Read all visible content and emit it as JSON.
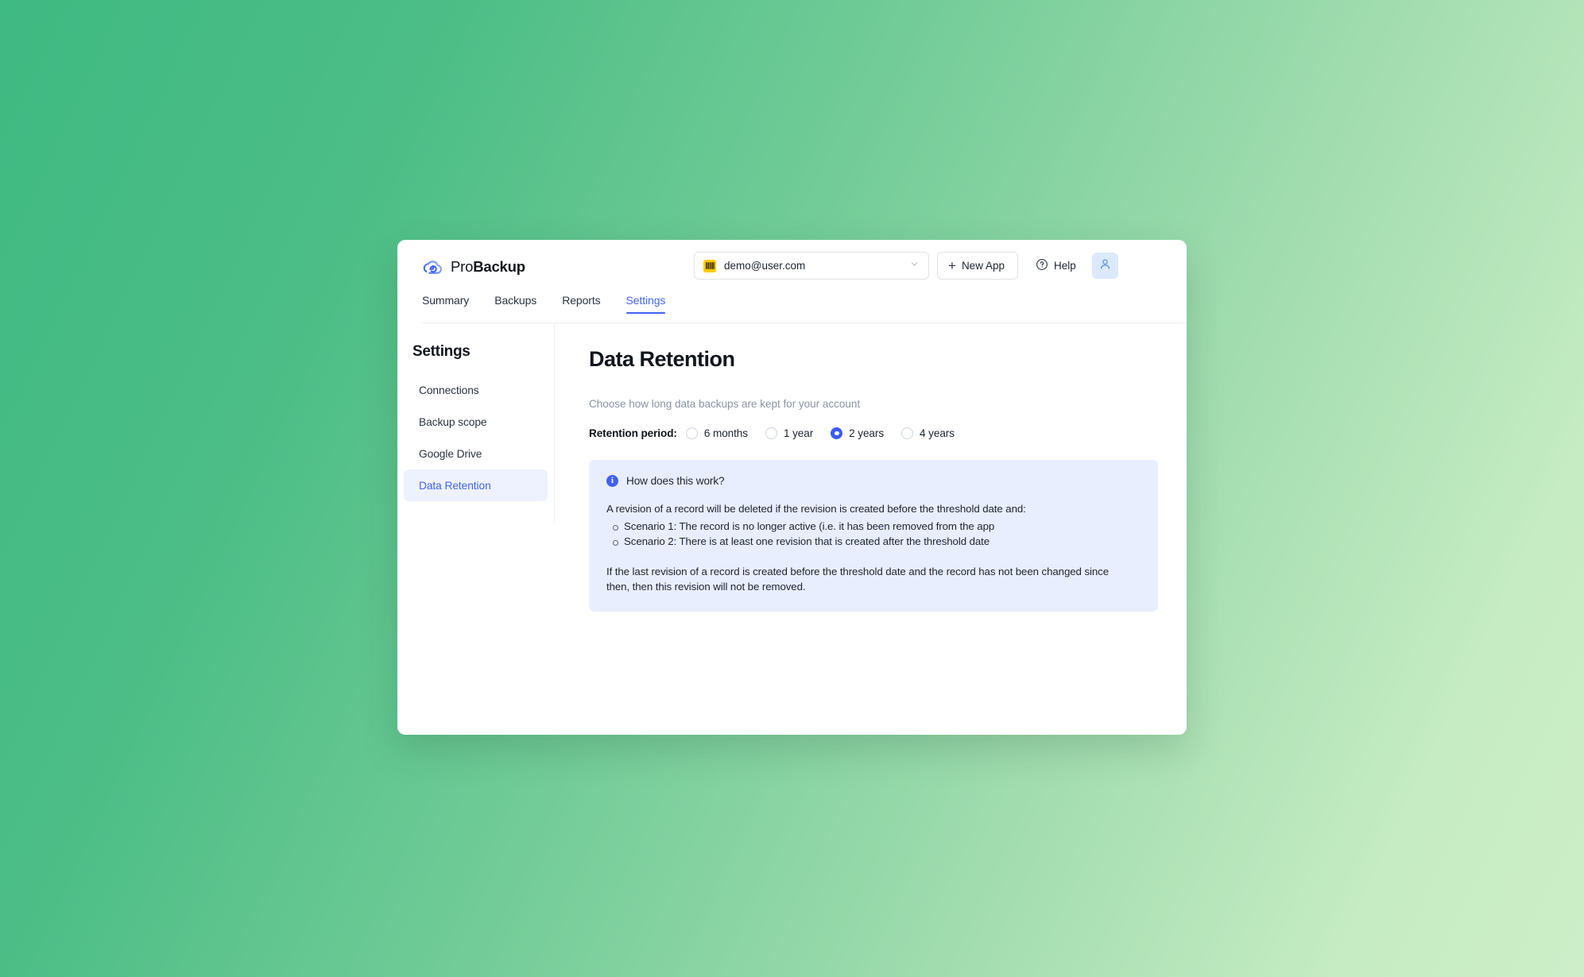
{
  "brand": {
    "name_light": "Pro",
    "name_bold": "Backup",
    "logo_icon": "cloud-refresh-icon"
  },
  "topbar": {
    "app_selector": {
      "value": "demo@user.com",
      "icon": "monday-app-icon",
      "chevron_icon": "chevron-down-icon"
    },
    "new_app_button": {
      "label": "New App",
      "icon": "plus-icon"
    },
    "help_button": {
      "label": "Help",
      "icon": "question-circle-icon"
    },
    "avatar": {
      "icon": "user-avatar-icon"
    }
  },
  "tabs": [
    {
      "label": "Summary",
      "active": false
    },
    {
      "label": "Backups",
      "active": false
    },
    {
      "label": "Reports",
      "active": false
    },
    {
      "label": "Settings",
      "active": true
    }
  ],
  "sidebar": {
    "title": "Settings",
    "items": [
      {
        "label": "Connections",
        "active": false
      },
      {
        "label": "Backup scope",
        "active": false
      },
      {
        "label": "Google Drive",
        "active": false
      },
      {
        "label": "Data Retention",
        "active": true
      }
    ]
  },
  "main": {
    "page_title": "Data Retention",
    "subtitle": "Choose how long data backups are kept for your account",
    "retention": {
      "label": "Retention period:",
      "options": [
        {
          "label": "6 months",
          "selected": false
        },
        {
          "label": "1 year",
          "selected": false
        },
        {
          "label": "2 years",
          "selected": true
        },
        {
          "label": "4 years",
          "selected": false
        }
      ]
    },
    "info_panel": {
      "icon": "info-icon",
      "heading": "How does this work?",
      "intro": "A revision of a record will be deleted if the revision is created before the threshold date and:",
      "scenarios": [
        "Scenario 1: The record is no longer active (i.e. it has been removed from the app",
        "Scenario 2: There is at least one revision that is created after the threshold date"
      ],
      "closing": "If the last revision of a record is created before the threshold date and the record has not been changed since then, then this revision will not be removed."
    }
  },
  "colors": {
    "accent": "#4263f0",
    "radio_selected": "#3b5cf5",
    "info_panel_bg": "#e9eeff",
    "sidebar_active_bg": "#eef2fe",
    "app_icon_bg": "#ffcb00",
    "avatar_bg": "#dbe9fb",
    "background_gradient_start": "#3fba82",
    "background_gradient_end": "#cdeec8"
  }
}
